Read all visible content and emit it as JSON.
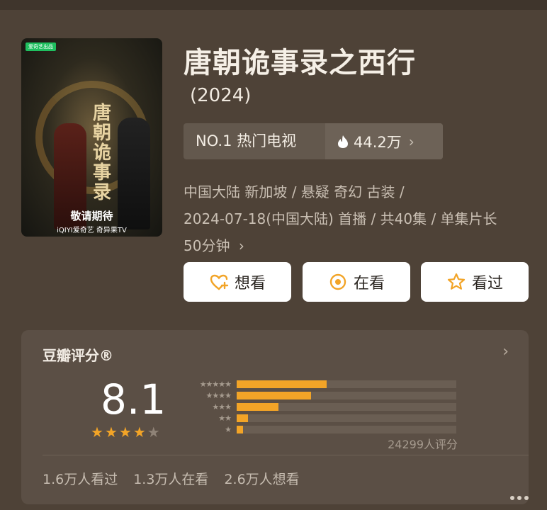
{
  "poster": {
    "tag": "爱奇艺出品",
    "calligraphy": "唐朝诡事录",
    "coming_soon": "敬请期待",
    "platforms": "iQIYI爱奇艺  奇异果TV"
  },
  "title": "唐朝诡事录之西行",
  "year": "(2024)",
  "rank": {
    "label": "NO.1 热门电视",
    "heat": "44.2万"
  },
  "meta": {
    "line1": "中国大陆 新加坡 / 悬疑 奇幻 古装 /",
    "line2": "2024-07-18(中国大陆) 首播 / 共40集 / 单集片长",
    "line3": "50分钟"
  },
  "actions": {
    "want": "想看",
    "watching": "在看",
    "watched": "看过"
  },
  "rating": {
    "title": "豆瓣评分®",
    "score": "8.1",
    "stars": 4,
    "count": "24299人评分",
    "distribution": [
      0.41,
      0.34,
      0.19,
      0.05,
      0.03
    ],
    "star_labels": [
      "★★★★★",
      "★★★★",
      "★★★",
      "★★",
      "★"
    ]
  },
  "stats": {
    "watched": "1.6万人看过",
    "watching": "1.3万人在看",
    "want": "2.6万人想看"
  },
  "colors": {
    "background": "#4e4237",
    "accent": "#f2a427",
    "card": "#5b4f45"
  }
}
